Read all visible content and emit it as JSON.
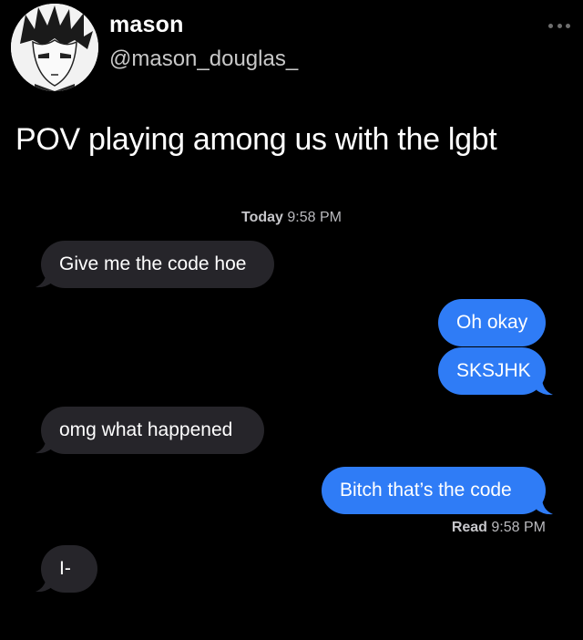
{
  "tweet": {
    "display_name": "mason",
    "handle": "@mason_douglas_",
    "text": "POV playing among us with the lgbt"
  },
  "conversation": {
    "timestamp_day": "Today",
    "timestamp_time": "9:58 PM",
    "messages": [
      {
        "direction": "incoming",
        "text": "Give me the code hoe"
      },
      {
        "direction": "outgoing",
        "text": "Oh okay"
      },
      {
        "direction": "outgoing",
        "text": "SKSJHK"
      },
      {
        "direction": "incoming",
        "text": "omg what happened"
      },
      {
        "direction": "outgoing",
        "text": "Bitch that’s the code"
      },
      {
        "direction": "incoming",
        "text": "I-"
      }
    ],
    "read_label": "Read",
    "read_time": "9:58 PM"
  },
  "colors": {
    "background": "#000000",
    "incoming_bubble": "#26252a",
    "outgoing_bubble": "#2f7cf6",
    "meta_text": "#b9b9bd"
  },
  "icons": {
    "avatar": "manga-character-avatar",
    "more": "more-dots-icon"
  }
}
